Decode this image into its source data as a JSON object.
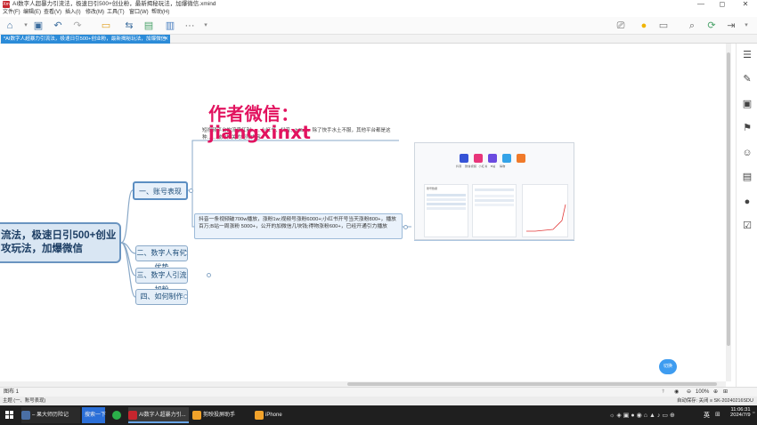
{
  "window": {
    "app_badge": "Xm",
    "title": "AI数字人超暴力引流法，极速日引500+创业粉，最新揭秘玩法，加爆微信.xmind",
    "minimize": "—",
    "maximize": "◻",
    "close": "✕"
  },
  "menu": [
    "文件(F)",
    "编辑(E)",
    "查看(V)",
    "插入(I)",
    "修改(M)",
    "工具(T)",
    "窗口(W)",
    "帮助(H)"
  ],
  "tab": {
    "label": "*AI数字人超暴力引流法，极速日引500+创业粉，最新揭秘玩法，加爆微信",
    "close": "✕"
  },
  "mindmap": {
    "root_line1": "流法，极速日引500+创业",
    "root_line2": "攻玩法，加爆微信",
    "topics": [
      "一、账号表现",
      "二、数字人有何优势",
      "三、数字人引流加粉",
      "四、如何制作"
    ],
    "background_text": "短视频平台的流量红利……小红书、抖音、bilibili、除了快手水土不服，其他平台都是这种……做AI相关的矩阵内容",
    "detail_text": "抖音一条视频破700w播放，涨粉1w;视频号涨粉6000+;小红书开号当天涨粉800+，播放百万;B站一周涨粉 5000+，公开的加微信几块钱;得物涨粉600+，已经开通引力播放"
  },
  "watermark": {
    "line1": "作者微信：",
    "line2": "jiangxinxt"
  },
  "embedded_image": {
    "app_labels": [
      "抖音",
      "微信视频",
      "小红书",
      "B站",
      "得物"
    ],
    "stats_title": "账号数据"
  },
  "float_button": "切换",
  "sheet": {
    "tab_label": "图布 1",
    "zoom": "100%"
  },
  "status": {
    "left": "主题 (一、账号表现)",
    "right": "自动保存: 关闭  ≡ SK-20240216SDU"
  },
  "taskbar": {
    "items": [
      "– 果大师历险记",
      "搜索一下",
      "AI数字人超暴力引...",
      "剪映投屏助手",
      "iPhone"
    ],
    "time": "11:06:31",
    "date": "2024/7/9",
    "lang": "英"
  }
}
